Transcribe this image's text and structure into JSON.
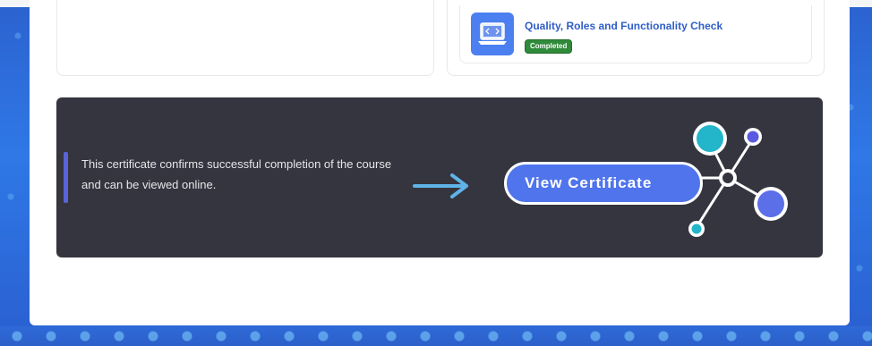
{
  "task": {
    "title": "Quality, Roles and Functionality Check",
    "status": "Completed",
    "icon": "laptop-icon",
    "status_color": "#2f8a3a"
  },
  "banner": {
    "text": "This certificate confirms successful completion of the course and can be viewed online.",
    "button_label": "View Certificate",
    "arrow_icon": "arrow-right-icon",
    "decor_icon": "network-nodes-icon",
    "colors": {
      "background": "#35353f",
      "button": "#4f74ec",
      "accent": "#5a63d8",
      "arrow": "#5fb3e8"
    }
  }
}
